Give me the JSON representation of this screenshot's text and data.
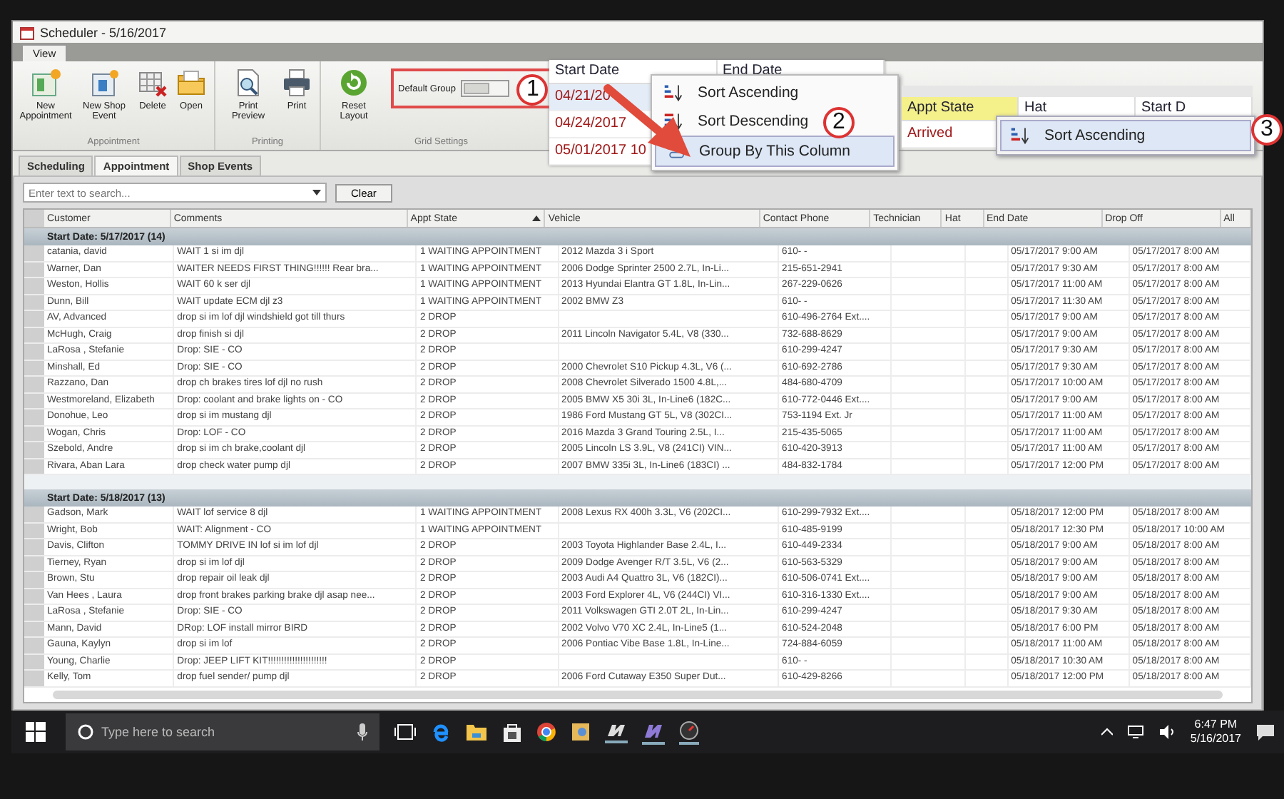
{
  "window": {
    "title": "Scheduler - 5/16/2017"
  },
  "ribbon_tabs": [
    {
      "label": "View",
      "selected": true
    }
  ],
  "ribbon_groups": [
    {
      "label": "Appointment",
      "buttons": [
        {
          "label": "New Appointment",
          "kind": "new"
        },
        {
          "label": "New Shop Event",
          "kind": "event"
        },
        {
          "label": "Delete",
          "kind": "delete"
        },
        {
          "label": "Open",
          "kind": "open"
        }
      ]
    },
    {
      "label": "Printing",
      "buttons": [
        {
          "label": "Print Preview",
          "kind": "preview"
        },
        {
          "label": "Print",
          "kind": "print"
        }
      ]
    },
    {
      "label": "Grid Settings",
      "buttons": [
        {
          "label": "Reset Layout",
          "kind": "reset"
        }
      ],
      "toggle": {
        "label": "Default Group",
        "on": false,
        "badge": "1"
      }
    }
  ],
  "tabs": [
    {
      "label": "Scheduling",
      "selected": false
    },
    {
      "label": "Appointment",
      "selected": true
    },
    {
      "label": "Shop Events",
      "selected": false
    }
  ],
  "search": {
    "placeholder": "Enter text to search...",
    "button": "Clear"
  },
  "table": {
    "columns": [
      {
        "label": "Customer"
      },
      {
        "label": "Comments"
      },
      {
        "label": "Appt State",
        "sorted": true
      },
      {
        "label": "Vehicle"
      },
      {
        "label": "Contact Phone"
      },
      {
        "label": "Technician"
      },
      {
        "label": "Hat"
      },
      {
        "label": "End Date"
      },
      {
        "label": "Drop Off"
      },
      {
        "label": "All"
      }
    ],
    "groups": [
      {
        "label": "Start Date: 5/17/2017 (14)",
        "rows": [
          {
            "customer": "catania, david",
            "comments": "WAIT  1  si im djl",
            "appt_state": "1 WAITING APPOINTMENT",
            "vehicle": "2012 Mazda 3 i Sport",
            "phone": "610-  -",
            "end_date": "05/17/2017 9:00 AM",
            "drop_off": "05/17/2017 8:00 AM"
          },
          {
            "customer": "Warner, Dan",
            "comments": "WAITER    NEEDS FIRST THING!!!!!! Rear bra...",
            "appt_state": "1 WAITING APPOINTMENT",
            "vehicle": "2006 Dodge Sprinter 2500 2.7L, In-Li...",
            "phone": "215-651-2941",
            "end_date": "05/17/2017 9:30 AM",
            "drop_off": "05/17/2017 8:00 AM"
          },
          {
            "customer": "Weston, Hollis",
            "comments": "WAIT  60 k ser  djl",
            "appt_state": "1 WAITING APPOINTMENT",
            "vehicle": "2013 Hyundai Elantra GT 1.8L, In-Lin...",
            "phone": "267-229-0626",
            "end_date": "05/17/2017 11:00 AM",
            "drop_off": "05/17/2017 8:00 AM"
          },
          {
            "customer": "Dunn, Bill",
            "comments": "WAIT  update ECM  djl  z3",
            "appt_state": "1 WAITING APPOINTMENT",
            "vehicle": "2002 BMW Z3",
            "phone": "610-  -",
            "end_date": "05/17/2017 11:30 AM",
            "drop_off": "05/17/2017 8:00 AM"
          },
          {
            "customer": "AV, Advanced",
            "comments": "drop  si im lof  djl  windshield  got till thurs",
            "appt_state": "2 DROP",
            "phone": "610-496-2764 Ext....",
            "end_date": "05/17/2017 9:00 AM",
            "drop_off": "05/17/2017 8:00 AM"
          },
          {
            "customer": "McHugh, Craig",
            "comments": "drop finish si  djl",
            "appt_state": "2 DROP",
            "vehicle": "2011 Lincoln Navigator 5.4L, V8 (330...",
            "phone": "732-688-8629",
            "end_date": "05/17/2017 9:00 AM",
            "drop_off": "05/17/2017 8:00 AM"
          },
          {
            "customer": "LaRosa , Stefanie",
            "comments": "Drop: SIE - CO",
            "appt_state": "2 DROP",
            "phone": "610-299-4247",
            "end_date": "05/17/2017 9:30 AM",
            "drop_off": "05/17/2017 8:00 AM"
          },
          {
            "customer": "Minshall, Ed",
            "comments": "Drop: SIE - CO",
            "appt_state": "2 DROP",
            "vehicle": "2000 Chevrolet S10 Pickup 4.3L, V6 (...",
            "phone": "610-692-2786",
            "end_date": "05/17/2017 9:30 AM",
            "drop_off": "05/17/2017 8:00 AM"
          },
          {
            "customer": "Razzano, Dan",
            "comments": "drop  ch brakes tires  lof  djl no rush",
            "appt_state": "2 DROP",
            "vehicle": "2008 Chevrolet Silverado 1500 4.8L,...",
            "phone": "484-680-4709",
            "end_date": "05/17/2017 10:00 AM",
            "drop_off": "05/17/2017 8:00 AM"
          },
          {
            "customer": "Westmoreland, Elizabeth",
            "comments": "Drop: coolant and brake lights on - CO",
            "appt_state": "2 DROP",
            "vehicle": "2005 BMW X5 30i 3L, In-Line6 (182C...",
            "phone": "610-772-0446 Ext....",
            "end_date": "05/17/2017 9:00 AM",
            "drop_off": "05/17/2017 8:00 AM"
          },
          {
            "customer": "Donohue, Leo",
            "comments": "drop si im  mustang  djl",
            "appt_state": "2 DROP",
            "vehicle": "1986 Ford Mustang GT 5L, V8 (302CI...",
            "phone": "753-1194 Ext. Jr",
            "end_date": "05/17/2017 11:00 AM",
            "drop_off": "05/17/2017 8:00 AM"
          },
          {
            "customer": "Wogan, Chris",
            "comments": "Drop: LOF - CO",
            "appt_state": "2 DROP",
            "vehicle": "2016 Mazda 3 Grand Touring 2.5L, I...",
            "phone": "215-435-5065",
            "end_date": "05/17/2017 11:00 AM",
            "drop_off": "05/17/2017 8:00 AM"
          },
          {
            "customer": "Szebold, Andre",
            "comments": "drop si im ch brake,coolant  djl",
            "appt_state": "2 DROP",
            "vehicle": "2005 Lincoln LS 3.9L, V8 (241CI) VIN...",
            "phone": "610-420-3913",
            "end_date": "05/17/2017 11:00 AM",
            "drop_off": "05/17/2017 8:00 AM"
          },
          {
            "customer": "Rivara, Aban Lara",
            "comments": "drop  check water pump  djl",
            "appt_state": "2 DROP",
            "vehicle": "2007 BMW 335i 3L, In-Line6 (183CI) ...",
            "phone": "484-832-1784",
            "end_date": "05/17/2017 12:00 PM",
            "drop_off": "05/17/2017 8:00 AM"
          }
        ]
      },
      {
        "label": "Start Date: 5/18/2017 (13)",
        "rows": [
          {
            "customer": "Gadson, Mark",
            "comments": "WAIT lof service  8  djl",
            "appt_state": "1 WAITING APPOINTMENT",
            "vehicle": "2008 Lexus RX 400h 3.3L, V6 (202CI...",
            "phone": "610-299-7932 Ext....",
            "end_date": "05/18/2017 12:00 PM",
            "drop_off": "05/18/2017 8:00 AM"
          },
          {
            "customer": "Wright, Bob",
            "comments": "WAIT: Alignment - CO",
            "appt_state": "1 WAITING APPOINTMENT",
            "phone": "610-485-9199",
            "end_date": "05/18/2017 12:30 PM",
            "drop_off": "05/18/2017 10:00 AM"
          },
          {
            "customer": "Davis, Clifton",
            "comments": "TOMMY DRIVE IN  lof si im lof djl",
            "appt_state": "2 DROP",
            "vehicle": "2003 Toyota Highlander Base 2.4L, I...",
            "phone": "610-449-2334",
            "end_date": "05/18/2017 9:00 AM",
            "drop_off": "05/18/2017 8:00 AM"
          },
          {
            "customer": "Tierney, Ryan",
            "comments": "drop  si im lof  djl",
            "appt_state": "2 DROP",
            "vehicle": "2009 Dodge Avenger R/T 3.5L, V6 (2...",
            "phone": "610-563-5329",
            "end_date": "05/18/2017 9:00 AM",
            "drop_off": "05/18/2017 8:00 AM"
          },
          {
            "customer": "Brown, Stu",
            "comments": "drop repair oil leak  djl",
            "appt_state": "2 DROP",
            "vehicle": "2003 Audi A4 Quattro 3L, V6 (182CI)...",
            "phone": "610-506-0741 Ext....",
            "end_date": "05/18/2017 9:00 AM",
            "drop_off": "05/18/2017 8:00 AM"
          },
          {
            "customer": "Van Hees  , Laura",
            "comments": "drop  front brakes parking brake  djl asap nee...",
            "appt_state": "2 DROP",
            "vehicle": "2003 Ford Explorer 4L, V6 (244CI) VI...",
            "phone": "610-316-1330 Ext....",
            "end_date": "05/18/2017 9:00 AM",
            "drop_off": "05/18/2017 8:00 AM"
          },
          {
            "customer": "LaRosa , Stefanie",
            "comments": "Drop: SIE - CO",
            "appt_state": "2 DROP",
            "vehicle": "2011 Volkswagen GTI 2.0T 2L, In-Lin...",
            "phone": "610-299-4247",
            "end_date": "05/18/2017 9:30 AM",
            "drop_off": "05/18/2017 8:00 AM"
          },
          {
            "customer": "Mann, David",
            "comments": "DRop: LOF install mirror    BIRD",
            "appt_state": "2 DROP",
            "vehicle": "2002 Volvo V70 XC 2.4L, In-Line5 (1...",
            "phone": "610-524-2048",
            "end_date": "05/18/2017 6:00 PM",
            "drop_off": "05/18/2017 8:00 AM"
          },
          {
            "customer": "Gauna, Kaylyn",
            "comments": "drop si im lof",
            "appt_state": "2 DROP",
            "vehicle": "2006 Pontiac Vibe Base 1.8L, In-Line...",
            "phone": "724-884-6059",
            "end_date": "05/18/2017 11:00 AM",
            "drop_off": "05/18/2017 8:00 AM"
          },
          {
            "customer": "Young, Charlie",
            "comments": "Drop: JEEP LIFT KIT!!!!!!!!!!!!!!!!!!!!!!",
            "appt_state": "2 DROP",
            "phone": "610-  -",
            "end_date": "05/18/2017 10:30 AM",
            "drop_off": "05/18/2017 8:00 AM"
          },
          {
            "customer": "Kelly, Tom",
            "comments": "drop  fuel sender/  pump  djl",
            "appt_state": "2 DROP",
            "vehicle": "2006 Ford Cutaway E350 Super Dut...",
            "phone": "610-429-8266",
            "end_date": "05/18/2017 12:00 PM",
            "drop_off": "05/18/2017 8:00 AM"
          }
        ]
      }
    ]
  },
  "callout_start_date": {
    "columns": [
      {
        "label": "Start Date"
      },
      {
        "label": "End Date"
      }
    ],
    "rows": [
      "04/21/20",
      "04/24/2017",
      "05/01/2017 10"
    ],
    "menu": [
      {
        "label": "Sort Ascending",
        "kind": "asc",
        "selected": false
      },
      {
        "label": "Sort Descending",
        "kind": "desc",
        "selected": false
      },
      {
        "label": "Group By This Column",
        "kind": "group",
        "selected": true
      }
    ],
    "badge": "2"
  },
  "callout_appt_state": {
    "columns": [
      {
        "label": "Appt State",
        "highlighted": true
      },
      {
        "label": "Hat",
        "highlighted": false
      },
      {
        "label": "Start D",
        "highlighted": false
      }
    ],
    "rows": [
      "Arrived"
    ],
    "menu": [
      {
        "label": "Sort Ascending",
        "kind": "asc",
        "selected": true
      }
    ],
    "badge": "3"
  },
  "taskbar": {
    "search_placeholder": "Type here to search",
    "time": "6:47 PM",
    "date": "5/16/2017"
  }
}
